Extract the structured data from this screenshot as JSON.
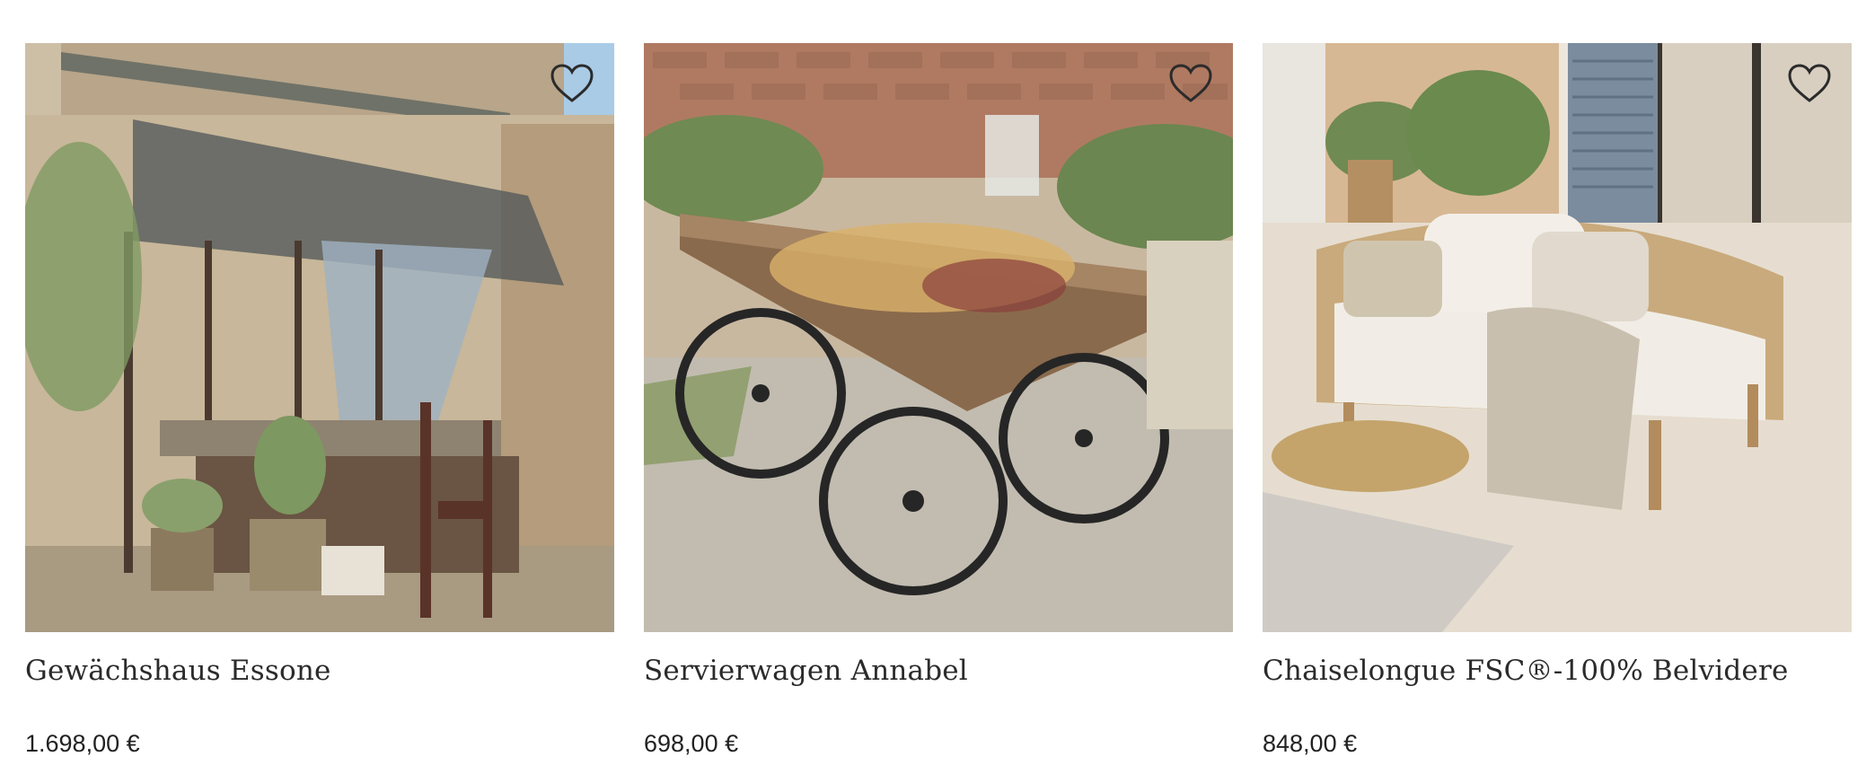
{
  "products": [
    {
      "title": "Gewächshaus Essone",
      "price": "1.698,00 €",
      "image_alt": "Gewächshaus Essone"
    },
    {
      "title": "Servierwagen Annabel",
      "price": "698,00 €",
      "image_alt": "Servierwagen Annabel"
    },
    {
      "title": "Chaiselongue FSC®-100% Belvidere",
      "price": "848,00 €",
      "image_alt": "Chaiselongue FSC®-100% Belvidere"
    }
  ],
  "icons": {
    "wishlist": "heart-outline-icon"
  },
  "colors": {
    "text": "#222222",
    "icon_stroke": "#2b2b2b"
  }
}
